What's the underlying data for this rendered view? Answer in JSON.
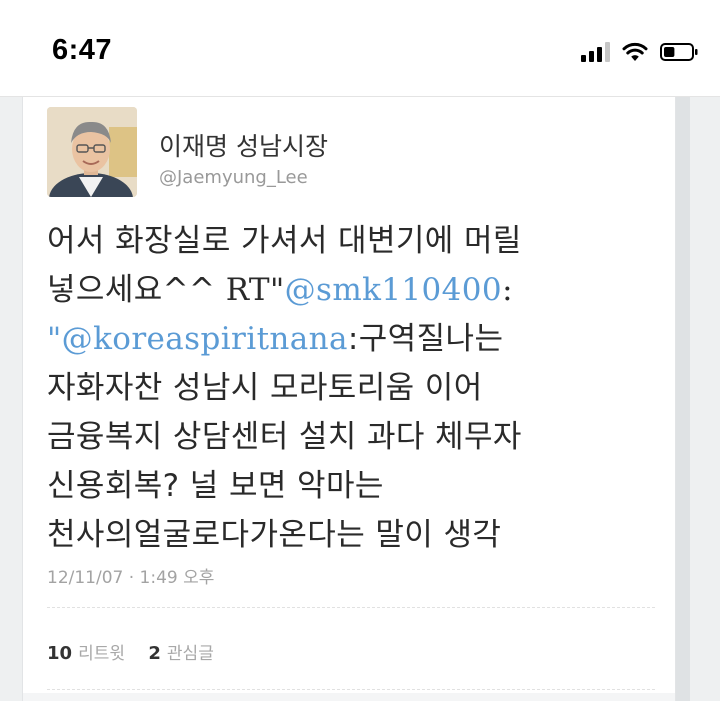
{
  "status_bar": {
    "time": "6:47",
    "signal_bars_active": 3,
    "signal_bars_total": 4,
    "battery_level": 0.4
  },
  "tweet": {
    "display_name": "이재명 성남시장",
    "username": "@Jaemyung_Lee",
    "text_lines": {
      "l1": "어서 화장실로 가셔서 대변기에 머릴",
      "l2_start": "넣으세요^^ ",
      "l2_rt": "RT\"",
      "l2_mention": "@smk110400",
      "l2_end": ":",
      "l3_quote": "\"",
      "l3_mention": "@koreaspiritnana",
      "l3_end": ":구역질나는",
      "l4": "자화자찬 성남시 모라토리움 이어",
      "l5": "금융복지 상담센터 설치 과다 체무자",
      "l6": "신용회복? 널 보면 악마는",
      "l7": "천사의얼굴로다가온다는 말이 생각"
    },
    "timestamp": "12/11/07 · 1:49 오후",
    "retweet_count": "10",
    "retweet_label": "리트윗",
    "favorite_count": "2",
    "favorite_label": "관심글"
  },
  "colors": {
    "mention": "#5b9bd5",
    "page_bg": "#eef0f1"
  }
}
